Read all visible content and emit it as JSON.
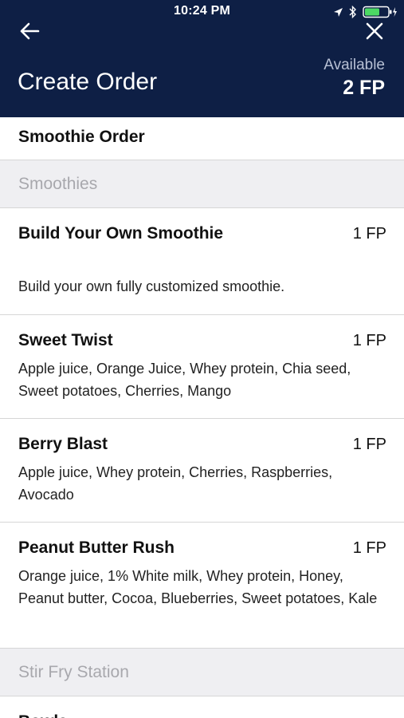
{
  "status_bar": {
    "time": "10:24 PM"
  },
  "header": {
    "title": "Create Order",
    "available_label": "Available",
    "available_value": "2 FP",
    "background_color": "#0e1f45"
  },
  "order": {
    "title": "Smoothie Order"
  },
  "sections": [
    {
      "label": "Smoothies",
      "items": [
        {
          "name": "Build Your Own Smoothie",
          "price": "1 FP",
          "description": "Build your own fully customized smoothie."
        },
        {
          "name": "Sweet Twist",
          "price": "1 FP",
          "description": "Apple juice, Orange Juice, Whey protein, Chia seed, Sweet potatoes, Cherries, Mango"
        },
        {
          "name": "Berry Blast",
          "price": "1 FP",
          "description": "Apple juice, Whey protein, Cherries, Raspberries, Avocado"
        },
        {
          "name": "Peanut Butter Rush",
          "price": "1 FP",
          "description": "Orange juice, 1% White milk, Whey protein, Honey, Peanut butter, Cocoa, Blueberries, Sweet potatoes, Kale"
        }
      ]
    },
    {
      "label": "Stir Fry Station",
      "items": [
        {
          "name": "Bowls"
        }
      ]
    }
  ],
  "icons": {
    "back": "arrow-left-icon",
    "close": "close-icon",
    "location": "location-arrow-icon",
    "bluetooth": "bluetooth-icon",
    "battery": "battery-charging-icon"
  }
}
